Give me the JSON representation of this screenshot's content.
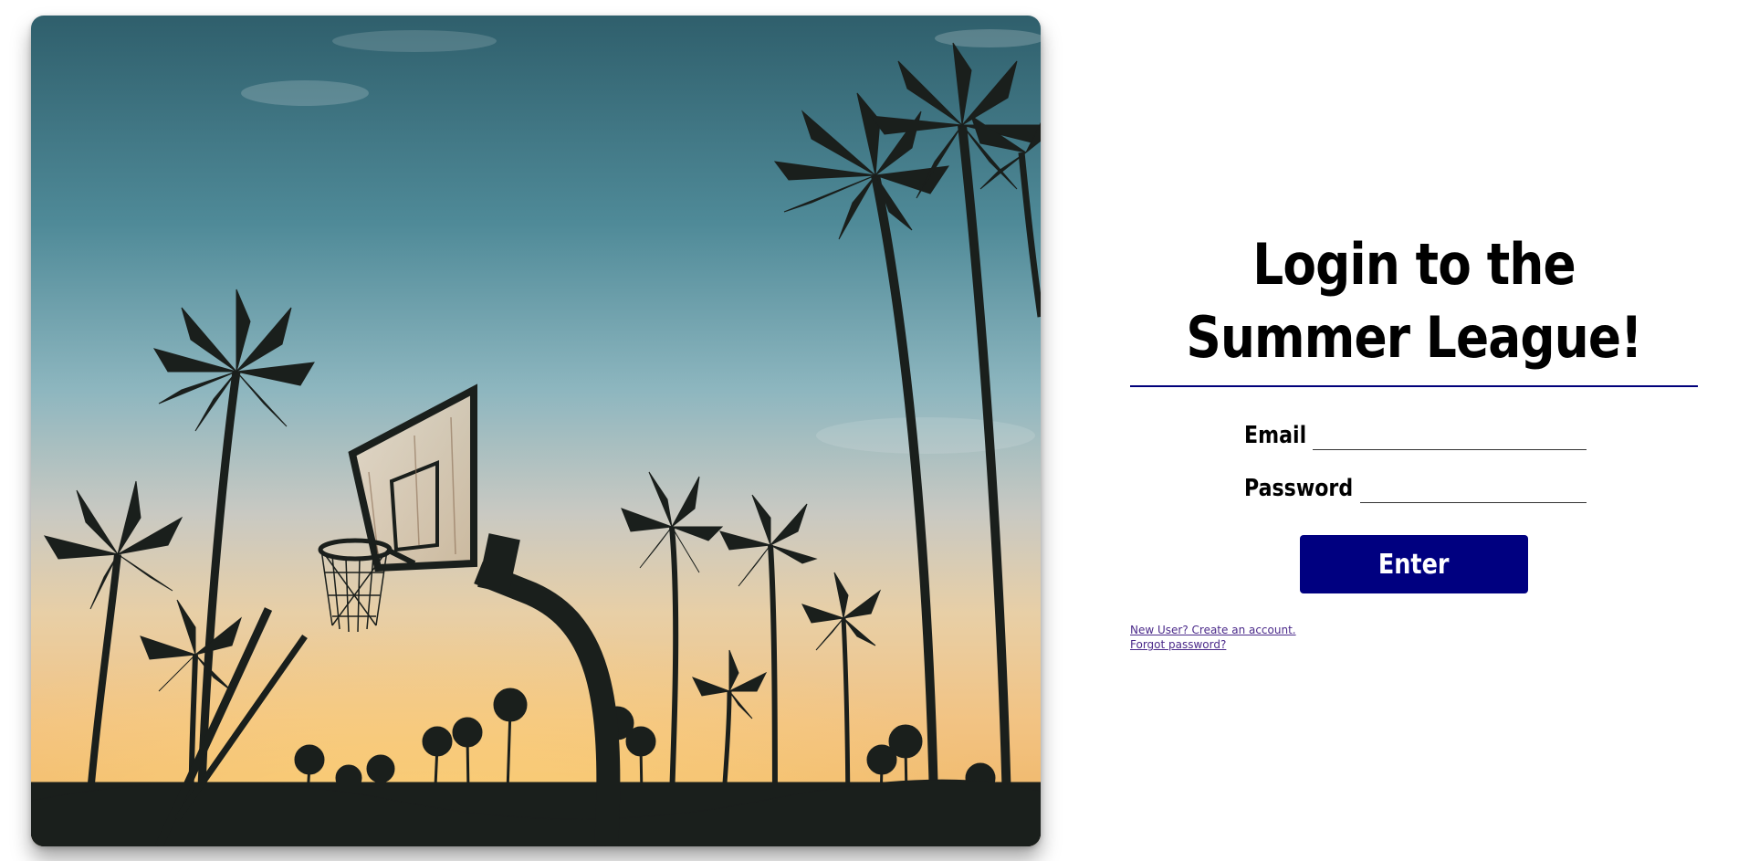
{
  "hero": {
    "image": "basketball-hoop-palm-trees-sunset"
  },
  "login": {
    "title": "Login to the Summer League!",
    "email_label": "Email",
    "email_value": "",
    "password_label": "Password",
    "password_value": "",
    "enter_label": "Enter",
    "create_account_link": "New User? Create an account.",
    "forgot_password_link": "Forgot password?"
  },
  "colors": {
    "accent": "#000080",
    "divider": "#00007a",
    "link": "#4b2a8a",
    "title": "#000000"
  }
}
